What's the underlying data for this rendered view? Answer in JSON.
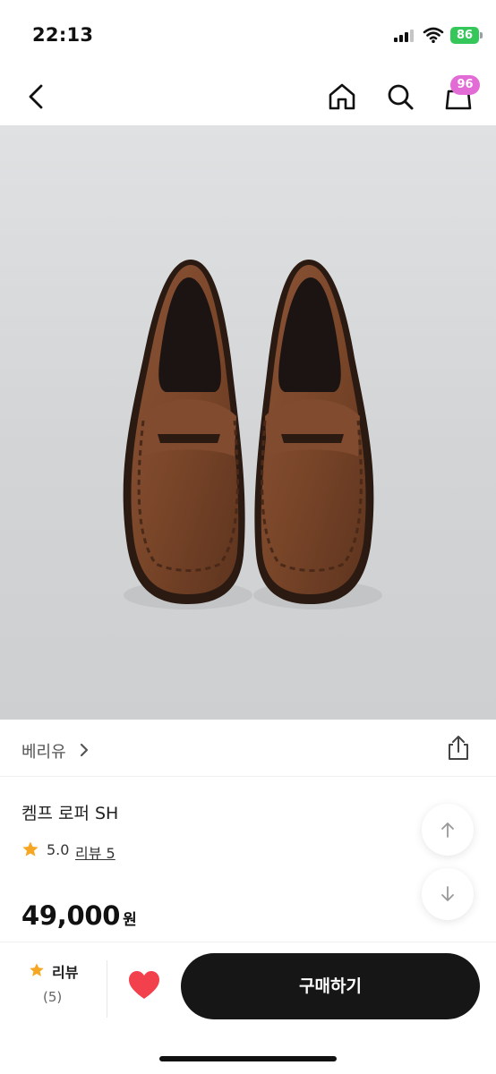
{
  "status_bar": {
    "time": "22:13",
    "battery_level": "86"
  },
  "nav": {
    "icons": [
      "back-icon",
      "home-icon",
      "search-icon",
      "shopping-bag-icon"
    ],
    "cart_badge": "96"
  },
  "product": {
    "image": "brown-suede-penny-loafers",
    "brand": "베리유",
    "name": "켐프 로퍼 SH",
    "rating": "5.0",
    "review_link": "리뷰 5",
    "price": "49,000",
    "currency": "원"
  },
  "bottom_bar": {
    "review_label": "리뷰",
    "review_count": "(5)",
    "buy_label": "구매하기"
  },
  "colors": {
    "battery": "#35c759",
    "badge": "#e36bd6",
    "star": "#f5a623",
    "like": "#f2404d",
    "buy_button": "#161616"
  }
}
